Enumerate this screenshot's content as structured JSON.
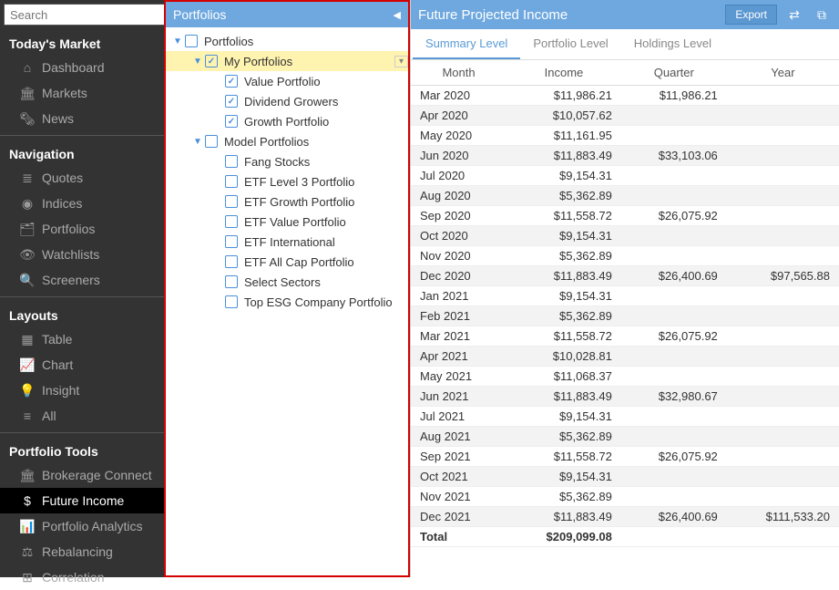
{
  "search": {
    "placeholder": "Search"
  },
  "sidebar": {
    "sections": [
      {
        "title": "Today's Market",
        "items": [
          {
            "icon": "dashboard",
            "label": "Dashboard"
          },
          {
            "icon": "markets",
            "label": "Markets"
          },
          {
            "icon": "news",
            "label": "News"
          }
        ]
      },
      {
        "title": "Navigation",
        "items": [
          {
            "icon": "quotes",
            "label": "Quotes"
          },
          {
            "icon": "indices",
            "label": "Indices"
          },
          {
            "icon": "portfolios",
            "label": "Portfolios"
          },
          {
            "icon": "watchlists",
            "label": "Watchlists"
          },
          {
            "icon": "screeners",
            "label": "Screeners"
          }
        ]
      },
      {
        "title": "Layouts",
        "items": [
          {
            "icon": "table",
            "label": "Table"
          },
          {
            "icon": "chart",
            "label": "Chart"
          },
          {
            "icon": "insight",
            "label": "Insight"
          },
          {
            "icon": "all",
            "label": "All"
          }
        ]
      },
      {
        "title": "Portfolio Tools",
        "items": [
          {
            "icon": "brokerage",
            "label": "Brokerage Connect"
          },
          {
            "icon": "future",
            "label": "Future Income",
            "active": true
          },
          {
            "icon": "analytics",
            "label": "Portfolio Analytics"
          },
          {
            "icon": "rebalancing",
            "label": "Rebalancing"
          },
          {
            "icon": "correlation",
            "label": "Correlation"
          }
        ]
      }
    ]
  },
  "tree": {
    "header": "Portfolios",
    "nodes": [
      {
        "depth": 0,
        "expand": "▼",
        "checked": false,
        "label": "Portfolios"
      },
      {
        "depth": 1,
        "expand": "▼",
        "checked": true,
        "label": "My Portfolios",
        "selected": true,
        "dropdown": true
      },
      {
        "depth": 2,
        "expand": "",
        "checked": true,
        "label": "Value Portfolio"
      },
      {
        "depth": 2,
        "expand": "",
        "checked": true,
        "label": "Dividend Growers"
      },
      {
        "depth": 2,
        "expand": "",
        "checked": true,
        "label": "Growth Portfolio"
      },
      {
        "depth": 1,
        "expand": "▼",
        "checked": false,
        "label": "Model Portfolios"
      },
      {
        "depth": 2,
        "expand": "",
        "checked": false,
        "label": "Fang Stocks"
      },
      {
        "depth": 2,
        "expand": "",
        "checked": false,
        "label": "ETF Level 3 Portfolio"
      },
      {
        "depth": 2,
        "expand": "",
        "checked": false,
        "label": "ETF Growth Portfolio"
      },
      {
        "depth": 2,
        "expand": "",
        "checked": false,
        "label": "ETF Value Portfolio"
      },
      {
        "depth": 2,
        "expand": "",
        "checked": false,
        "label": "ETF International"
      },
      {
        "depth": 2,
        "expand": "",
        "checked": false,
        "label": "ETF All Cap Portfolio"
      },
      {
        "depth": 2,
        "expand": "",
        "checked": false,
        "label": "Select Sectors"
      },
      {
        "depth": 2,
        "expand": "",
        "checked": false,
        "label": "Top ESG Company Portfolio"
      }
    ]
  },
  "content": {
    "title": "Future Projected Income",
    "export_label": "Export",
    "tabs": [
      {
        "label": "Summary Level",
        "active": true
      },
      {
        "label": "Portfolio Level"
      },
      {
        "label": "Holdings Level"
      }
    ],
    "columns": [
      "Month",
      "Income",
      "Quarter",
      "Year"
    ],
    "rows": [
      {
        "month": "Mar 2020",
        "income": "$11,986.21",
        "quarter": "$11,986.21",
        "year": ""
      },
      {
        "month": "Apr 2020",
        "income": "$10,057.62",
        "quarter": "",
        "year": ""
      },
      {
        "month": "May 2020",
        "income": "$11,161.95",
        "quarter": "",
        "year": ""
      },
      {
        "month": "Jun 2020",
        "income": "$11,883.49",
        "quarter": "$33,103.06",
        "year": ""
      },
      {
        "month": "Jul 2020",
        "income": "$9,154.31",
        "quarter": "",
        "year": ""
      },
      {
        "month": "Aug 2020",
        "income": "$5,362.89",
        "quarter": "",
        "year": ""
      },
      {
        "month": "Sep 2020",
        "income": "$11,558.72",
        "quarter": "$26,075.92",
        "year": ""
      },
      {
        "month": "Oct 2020",
        "income": "$9,154.31",
        "quarter": "",
        "year": ""
      },
      {
        "month": "Nov 2020",
        "income": "$5,362.89",
        "quarter": "",
        "year": ""
      },
      {
        "month": "Dec 2020",
        "income": "$11,883.49",
        "quarter": "$26,400.69",
        "year": "$97,565.88"
      },
      {
        "month": "Jan 2021",
        "income": "$9,154.31",
        "quarter": "",
        "year": ""
      },
      {
        "month": "Feb 2021",
        "income": "$5,362.89",
        "quarter": "",
        "year": ""
      },
      {
        "month": "Mar 2021",
        "income": "$11,558.72",
        "quarter": "$26,075.92",
        "year": ""
      },
      {
        "month": "Apr 2021",
        "income": "$10,028.81",
        "quarter": "",
        "year": ""
      },
      {
        "month": "May 2021",
        "income": "$11,068.37",
        "quarter": "",
        "year": ""
      },
      {
        "month": "Jun 2021",
        "income": "$11,883.49",
        "quarter": "$32,980.67",
        "year": ""
      },
      {
        "month": "Jul 2021",
        "income": "$9,154.31",
        "quarter": "",
        "year": ""
      },
      {
        "month": "Aug 2021",
        "income": "$5,362.89",
        "quarter": "",
        "year": ""
      },
      {
        "month": "Sep 2021",
        "income": "$11,558.72",
        "quarter": "$26,075.92",
        "year": ""
      },
      {
        "month": "Oct 2021",
        "income": "$9,154.31",
        "quarter": "",
        "year": ""
      },
      {
        "month": "Nov 2021",
        "income": "$5,362.89",
        "quarter": "",
        "year": ""
      },
      {
        "month": "Dec 2021",
        "income": "$11,883.49",
        "quarter": "$26,400.69",
        "year": "$111,533.20"
      }
    ],
    "total": {
      "month": "Total",
      "income": "$209,099.08",
      "quarter": "",
      "year": ""
    }
  },
  "icon_glyphs": {
    "dashboard": "⌂",
    "markets": "🏛",
    "news": "🗞",
    "quotes": "≣",
    "indices": "◉",
    "portfolios": "🗂",
    "watchlists": "👁",
    "screeners": "🔍",
    "table": "▦",
    "chart": "📈",
    "insight": "💡",
    "all": "≡",
    "brokerage": "🏛",
    "future": "$",
    "analytics": "📊",
    "rebalancing": "⚖",
    "correlation": "⊞"
  }
}
